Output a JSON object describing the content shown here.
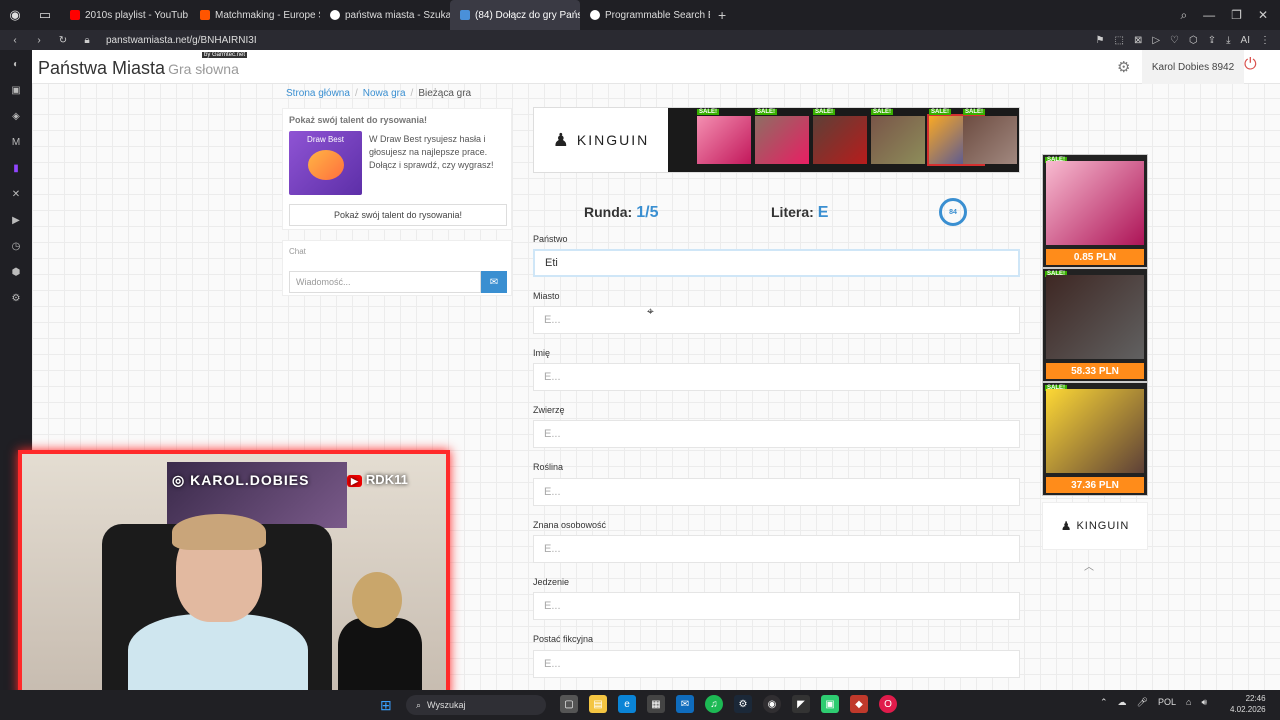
{
  "browser": {
    "tabs": [
      {
        "label": "2010s playlist - YouTub",
        "icon": "youtube-icon",
        "color": "#ff0000"
      },
      {
        "label": "Matchmaking - Europe Sv",
        "icon": "faceit-icon",
        "color": "#ff5500"
      },
      {
        "label": "państwa miasta - Szukaj w",
        "icon": "google-icon",
        "color": "#ffffff"
      },
      {
        "label": "(84) Dołącz do gry Państw",
        "icon": "panstwa-icon",
        "color": "#4a90d9",
        "active": true
      },
      {
        "label": "Programmable Search Eng",
        "icon": "google-icon",
        "color": "#ffffff"
      }
    ],
    "url": "panstwamiasta.net/g/BNHAIRNI3I",
    "extensions_label": "AI"
  },
  "header": {
    "title": "Państwa Miasta",
    "subtitle": "Gra słowna",
    "garmtec_badge": "by Garmtec.net",
    "user": "Karol Dobies 8942"
  },
  "breadcrumb": {
    "home": "Strona główna",
    "new_game": "Nowa gra",
    "current": "Bieżąca gra"
  },
  "promo": {
    "title": "Pokaż swój talent do rysowania!",
    "image_caption": "Draw Best",
    "text": "W Draw Best rysujesz hasła i głosujesz na najlepsze prace. Dołącz i sprawdź, czy wygrasz!",
    "button": "Pokaż swój talent do rysowania!"
  },
  "chat": {
    "title": "Chat",
    "placeholder": "Wiadomość..."
  },
  "ad": {
    "brand": "KINGUIN",
    "sale_label": "SALE!",
    "side_prices": [
      "0.85 PLN",
      "58.33 PLN",
      "37.36 PLN"
    ]
  },
  "game": {
    "round_label": "Runda:",
    "round_value": "1/5",
    "letter_label": "Litera:",
    "letter_value": "E",
    "timer": "84",
    "fields": [
      {
        "label": "Państwo",
        "value": "Eti",
        "placeholder": "E..."
      },
      {
        "label": "Miasto",
        "value": "",
        "placeholder": "E..."
      },
      {
        "label": "Imię",
        "value": "",
        "placeholder": "E..."
      },
      {
        "label": "Zwierzę",
        "value": "",
        "placeholder": "E..."
      },
      {
        "label": "Roślina",
        "value": "",
        "placeholder": "E..."
      },
      {
        "label": "Znana osobowość",
        "value": "",
        "placeholder": "E..."
      },
      {
        "label": "Jedzenie",
        "value": "",
        "placeholder": "E..."
      },
      {
        "label": "Postać fikcyjna",
        "value": "",
        "placeholder": "E..."
      }
    ]
  },
  "webcam": {
    "instagram": "KAROL.DOBIES",
    "youtube": "RDK11",
    "youtube_badge": "▶"
  },
  "taskbar": {
    "search_placeholder": "Wyszukaj",
    "language": "POL",
    "time": "22:46",
    "date": "4.02.2026"
  },
  "colors": {
    "accent": "#3a8fd1",
    "webcam_border": "#ff2a2a",
    "price_tag": "#ff8c1a",
    "sale_badge": "#38b000"
  }
}
